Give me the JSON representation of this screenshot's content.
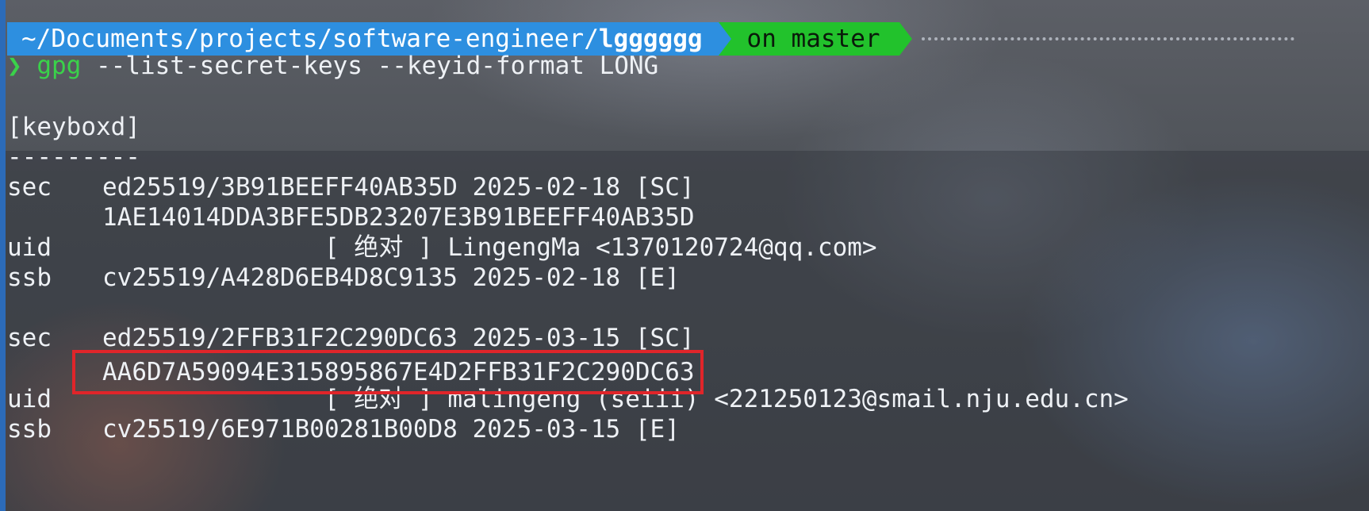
{
  "prompt": {
    "path_prefix": "~/Documents/projects/software-engineer/",
    "repo": "lgggggg",
    "git": "on master"
  },
  "command": {
    "chevron": "❯",
    "name": "gpg",
    "args": " --list-secret-keys --keyid-format LONG"
  },
  "output": {
    "keybox_header": "[keyboxd]",
    "separator": "---------",
    "keys": [
      {
        "sec_label": "sec",
        "sec_value": "ed25519/3B91BEEFF40AB35D 2025-02-18 [SC]",
        "fingerprint": "1AE14014DDA3BFE5DB23207E3B91BEEFF40AB35D",
        "uid_label": "uid",
        "uid_value": "[ 绝对 ] LingengMa <1370120724@qq.com>",
        "ssb_label": "ssb",
        "ssb_value": "cv25519/A428D6EB4D8C9135 2025-02-18 [E]"
      },
      {
        "sec_label": "sec",
        "sec_value": "ed25519/2FFB31F2C290DC63 2025-03-15 [SC]",
        "fingerprint": "AA6D7A59094E315895867E4D2FFB31F2C290DC63",
        "uid_label": "uid",
        "uid_value": "[ 绝对 ] malingeng (seiii) <221250123@smail.nju.edu.cn>",
        "ssb_label": "ssb",
        "ssb_value": "cv25519/6E971B00281B00D8 2025-03-15 [E]"
      }
    ]
  },
  "colors": {
    "path_segment": "#2d8fe0",
    "git_segment": "#22c22c",
    "highlight_box": "#e0252a",
    "command_green": "#3ad24a"
  }
}
